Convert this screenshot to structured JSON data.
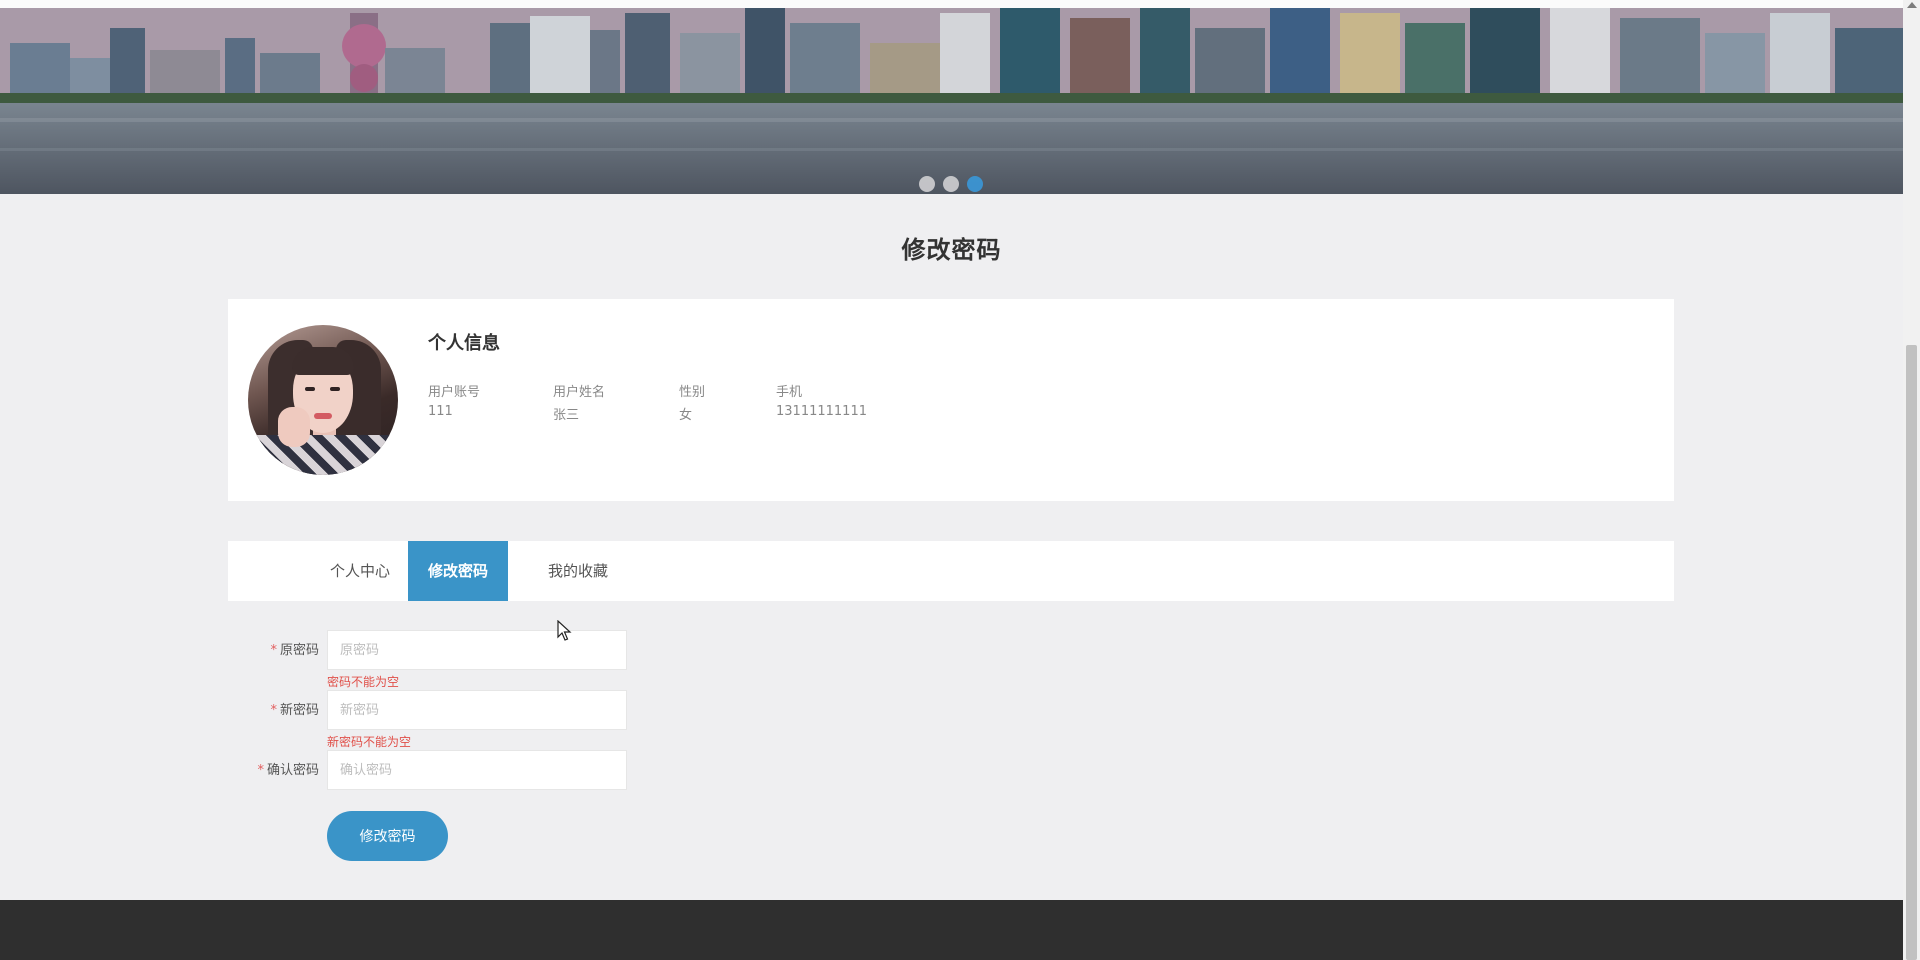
{
  "banner": {
    "dots": [
      {
        "active": false
      },
      {
        "active": false
      },
      {
        "active": true
      }
    ]
  },
  "page_title": "修改密码",
  "profile": {
    "heading": "个人信息",
    "fields": [
      {
        "label": "用户账号",
        "value": "111"
      },
      {
        "label": "用户姓名",
        "value": "张三"
      },
      {
        "label": "性别",
        "value": "女"
      },
      {
        "label": "手机",
        "value": "13111111111"
      }
    ]
  },
  "tabs": [
    {
      "label": "个人中心",
      "active": false
    },
    {
      "label": "修改密码",
      "active": true
    },
    {
      "label": "我的收藏",
      "active": false
    }
  ],
  "form": {
    "required_mark": "*",
    "old_password": {
      "label": "原密码",
      "placeholder": "原密码",
      "value": "",
      "error": "密码不能为空"
    },
    "new_password": {
      "label": "新密码",
      "placeholder": "新密码",
      "value": "",
      "error": "新密码不能为空"
    },
    "confirm_password": {
      "label": "确认密码",
      "placeholder": "确认密码",
      "value": ""
    },
    "submit_label": "修改密码"
  },
  "colors": {
    "accent": "#3a94c8",
    "error": "#e0504a",
    "footer": "#2f2f2f",
    "background": "#efeff1"
  },
  "icons": {
    "cursor": "mouse-pointer-icon"
  }
}
